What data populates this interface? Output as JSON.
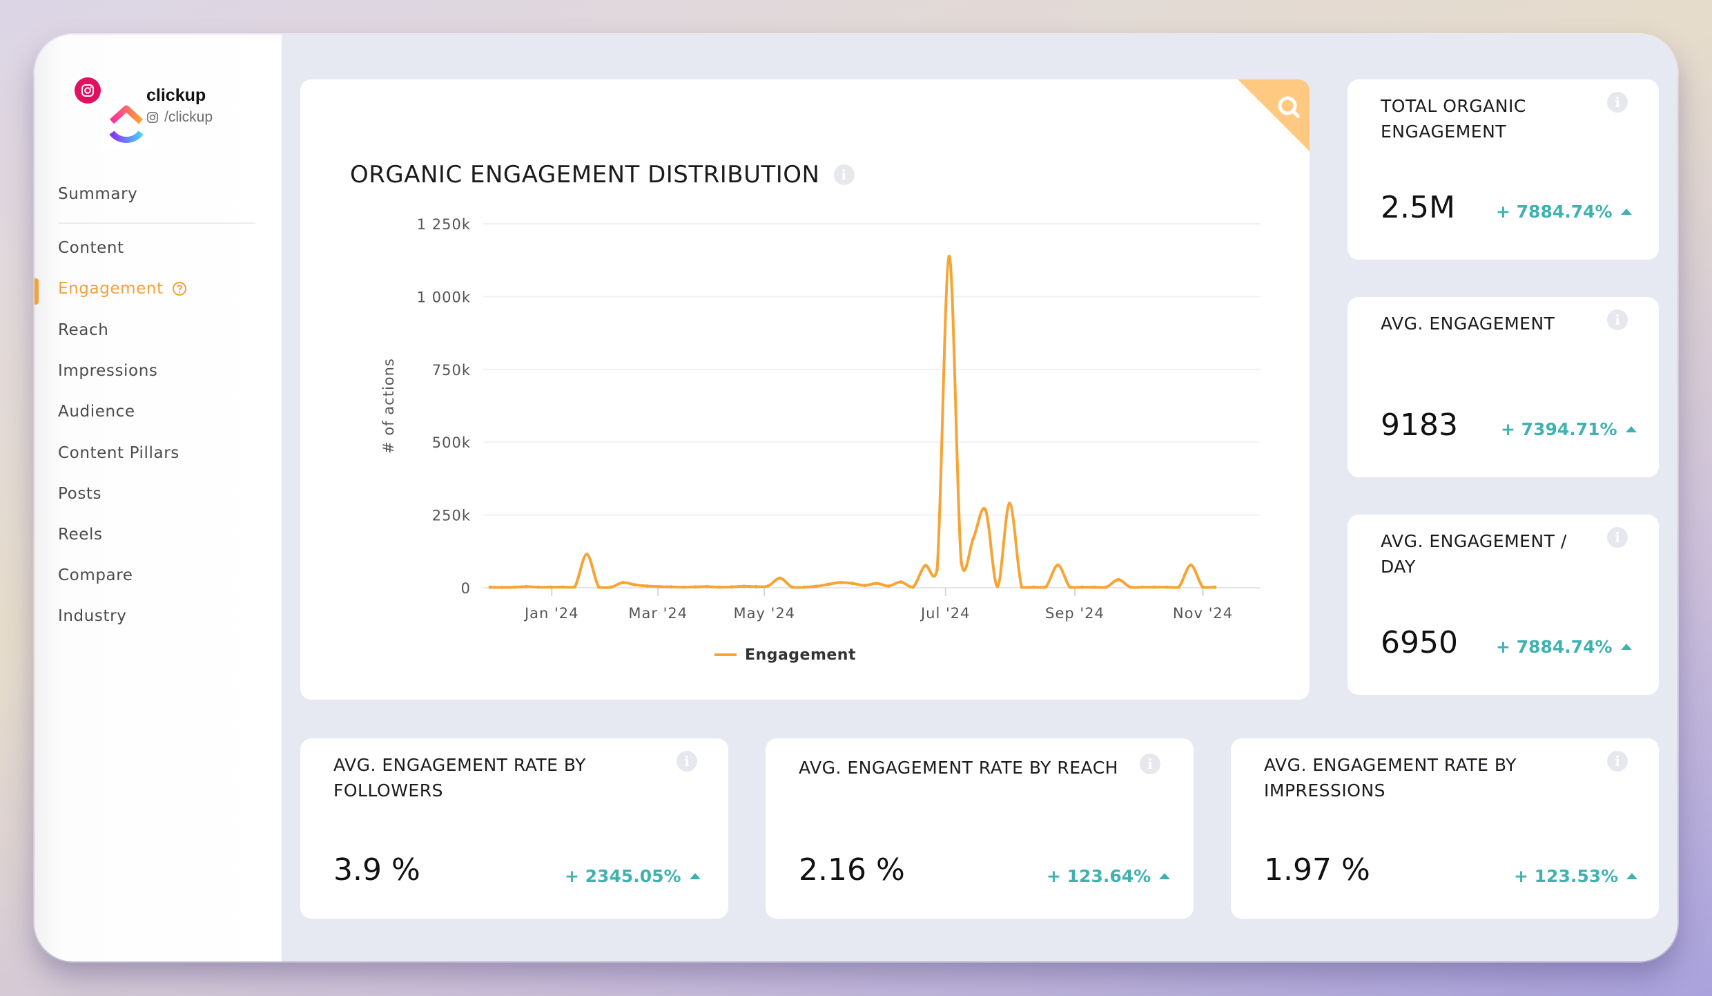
{
  "profile": {
    "name": "clickup",
    "handle": "/clickup",
    "platform_icon": "instagram-icon"
  },
  "sidebar": {
    "items": [
      {
        "label": "Summary",
        "active": false
      },
      {
        "label": "Content",
        "active": false
      },
      {
        "label": "Engagement",
        "active": true,
        "help_icon": "question-circle-icon"
      },
      {
        "label": "Reach",
        "active": false
      },
      {
        "label": "Impressions",
        "active": false
      },
      {
        "label": "Audience",
        "active": false
      },
      {
        "label": "Content Pillars",
        "active": false
      },
      {
        "label": "Posts",
        "active": false
      },
      {
        "label": "Reels",
        "active": false
      },
      {
        "label": "Compare",
        "active": false
      },
      {
        "label": "Industry",
        "active": false
      }
    ]
  },
  "colors": {
    "accent": "#f3a13b",
    "positive": "#3fb2b0",
    "instagram": "#e0115f",
    "corner_tab": "#ffc982"
  },
  "chart_card": {
    "title": "ORGANIC ENGAGEMENT DISTRIBUTION",
    "corner_icon": "search-icon"
  },
  "chart_data": {
    "type": "line",
    "title": "ORGANIC ENGAGEMENT DISTRIBUTION",
    "xlabel": "",
    "ylabel": "# of actions",
    "ylim": [
      0,
      1250000
    ],
    "yticks": [
      0,
      250000,
      500000,
      750000,
      1000000,
      1250000
    ],
    "ytick_labels": [
      "0",
      "250k",
      "500k",
      "750k",
      "1 000k",
      "1 250k"
    ],
    "xtick_labels": [
      "Jan '24",
      "Mar '24",
      "May '24",
      "Jul '24",
      "Sep '24",
      "Nov '24"
    ],
    "xtick_positions_week_index": [
      5.1,
      13.9,
      22.7,
      37.7,
      48.4,
      59.0
    ],
    "x_interval": "weekly",
    "grid": true,
    "legend": "bottom-center",
    "series": [
      {
        "name": "Engagement",
        "color": "#f7a435",
        "values": [
          2000,
          1500,
          2000,
          4000,
          2000,
          2000,
          2500,
          3000,
          115000,
          2000,
          2000,
          18000,
          10000,
          6000,
          4000,
          3000,
          2000,
          3000,
          4000,
          2000,
          3000,
          5000,
          4000,
          6000,
          33000,
          2000,
          2000,
          5000,
          12000,
          18000,
          15000,
          8000,
          15000,
          6000,
          20000,
          2000,
          76000,
          62000,
          1138000,
          88000,
          170000,
          268000,
          5000,
          290000,
          2000,
          2000,
          3000,
          78000,
          2000,
          2000,
          2000,
          2000,
          28000,
          2000,
          2000,
          2000,
          2000,
          2000,
          78000,
          2000,
          2000
        ]
      }
    ]
  },
  "stats_right": [
    {
      "title": "TOTAL ORGANIC ENGAGEMENT",
      "value": "2.5M",
      "change": "+ 7884.74%"
    },
    {
      "title": "AVG. ENGAGEMENT",
      "value": "9183",
      "change": "+ 7394.71%"
    },
    {
      "title": "AVG. ENGAGEMENT / DAY",
      "value": "6950",
      "change": "+ 7884.74%"
    }
  ],
  "stats_bottom": [
    {
      "title": "AVG. ENGAGEMENT RATE BY FOLLOWERS",
      "value": "3.9 %",
      "change": "+ 2345.05%"
    },
    {
      "title": "AVG. ENGAGEMENT RATE BY REACH",
      "value": "2.16 %",
      "change": "+ 123.64%"
    },
    {
      "title": "AVG. ENGAGEMENT RATE BY IMPRESSIONS",
      "value": "1.97 %",
      "change": "+ 123.53%"
    }
  ],
  "info_glyph": "i"
}
